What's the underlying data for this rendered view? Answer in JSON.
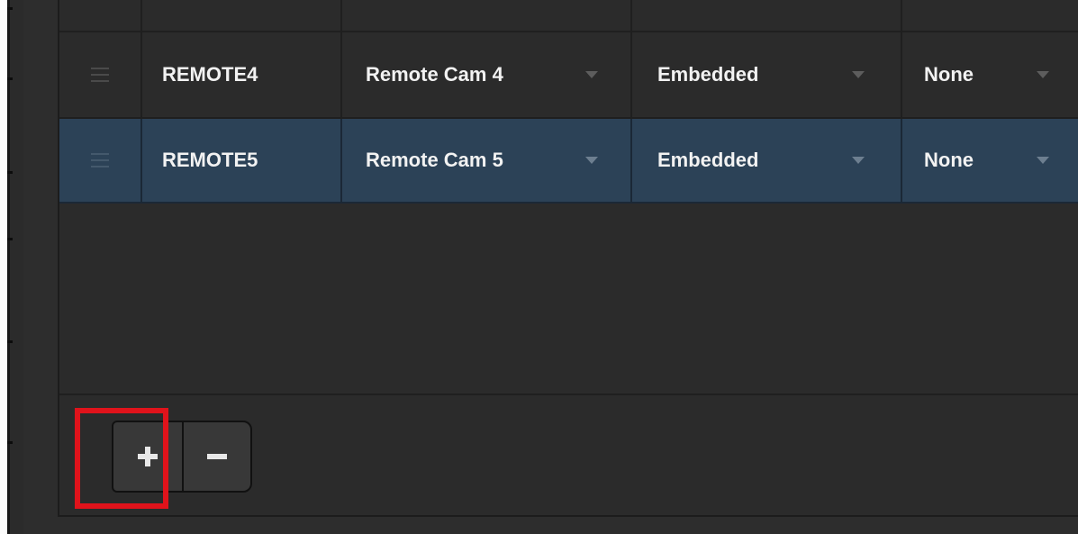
{
  "table": {
    "rows": [
      {
        "name": "REMOTE4",
        "camera": "Remote Cam 4",
        "audio": "Embedded",
        "mix": "None",
        "selected": false
      },
      {
        "name": "REMOTE5",
        "camera": "Remote Cam 5",
        "audio": "Embedded",
        "mix": "None",
        "selected": true
      }
    ]
  },
  "footer": {
    "add_icon": "plus-icon",
    "remove_icon": "minus-icon"
  },
  "colors": {
    "panel_bg": "#2d2d2d",
    "selected_row": "#2c4257",
    "highlight": "#e0131b",
    "text": "#f2f2f2"
  }
}
